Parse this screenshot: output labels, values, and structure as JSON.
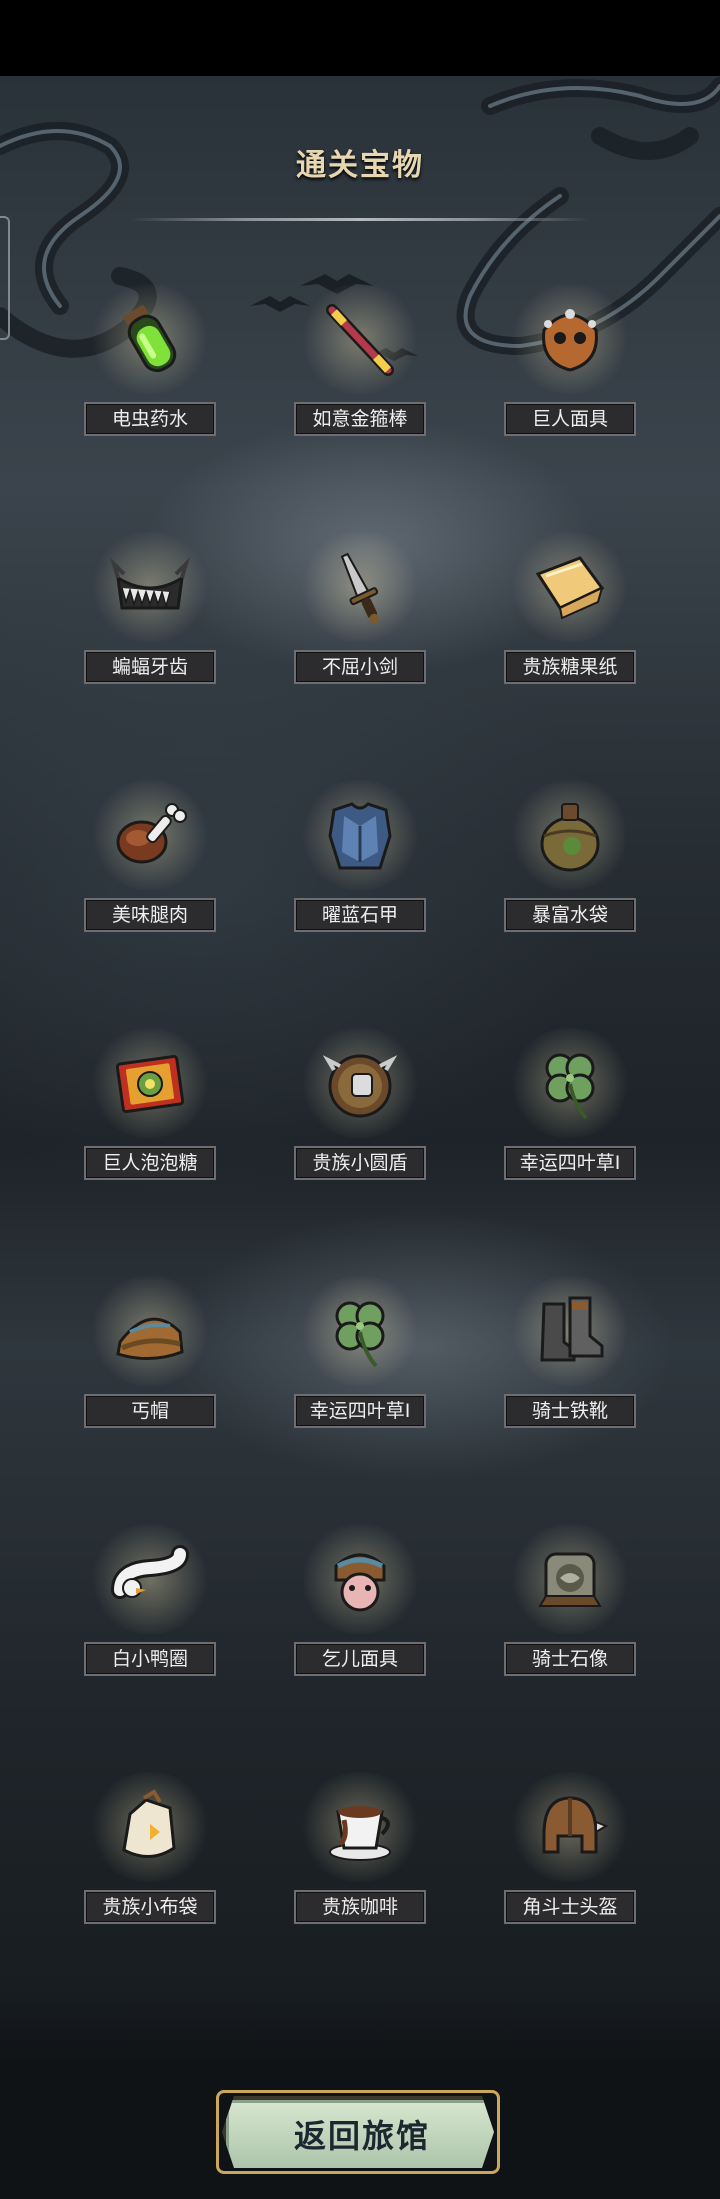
{
  "header": {
    "title": "通关宝物"
  },
  "treasures": [
    {
      "name": "电虫药水",
      "icon": "green-potion-vial-icon"
    },
    {
      "name": "如意金箍棒",
      "icon": "golden-staff-icon"
    },
    {
      "name": "巨人面具",
      "icon": "giant-mask-icon"
    },
    {
      "name": "蝙蝠牙齿",
      "icon": "bat-teeth-icon"
    },
    {
      "name": "不屈小剑",
      "icon": "small-sword-icon"
    },
    {
      "name": "贵族糖果纸",
      "icon": "candy-wrapper-icon"
    },
    {
      "name": "美味腿肉",
      "icon": "meat-leg-icon"
    },
    {
      "name": "曜蓝石甲",
      "icon": "blue-armor-icon"
    },
    {
      "name": "暴富水袋",
      "icon": "water-pouch-icon"
    },
    {
      "name": "巨人泡泡糖",
      "icon": "bubblegum-box-icon"
    },
    {
      "name": "贵族小圆盾",
      "icon": "round-shield-icon"
    },
    {
      "name": "幸运四叶草I",
      "icon": "four-leaf-clover-icon"
    },
    {
      "name": "丐帽",
      "icon": "beggar-hat-icon"
    },
    {
      "name": "幸运四叶草I",
      "icon": "four-leaf-clover-icon"
    },
    {
      "name": "骑士铁靴",
      "icon": "iron-boots-icon"
    },
    {
      "name": "白小鸭圈",
      "icon": "duck-ring-icon"
    },
    {
      "name": "乞儿面具",
      "icon": "beggar-mask-icon"
    },
    {
      "name": "骑士石像",
      "icon": "stone-statue-icon"
    },
    {
      "name": "贵族小布袋",
      "icon": "cloth-bag-icon"
    },
    {
      "name": "贵族咖啡",
      "icon": "coffee-cup-icon"
    },
    {
      "name": "角斗士头盔",
      "icon": "gladiator-helmet-icon"
    }
  ],
  "footer": {
    "return_label": "返回旅馆"
  }
}
